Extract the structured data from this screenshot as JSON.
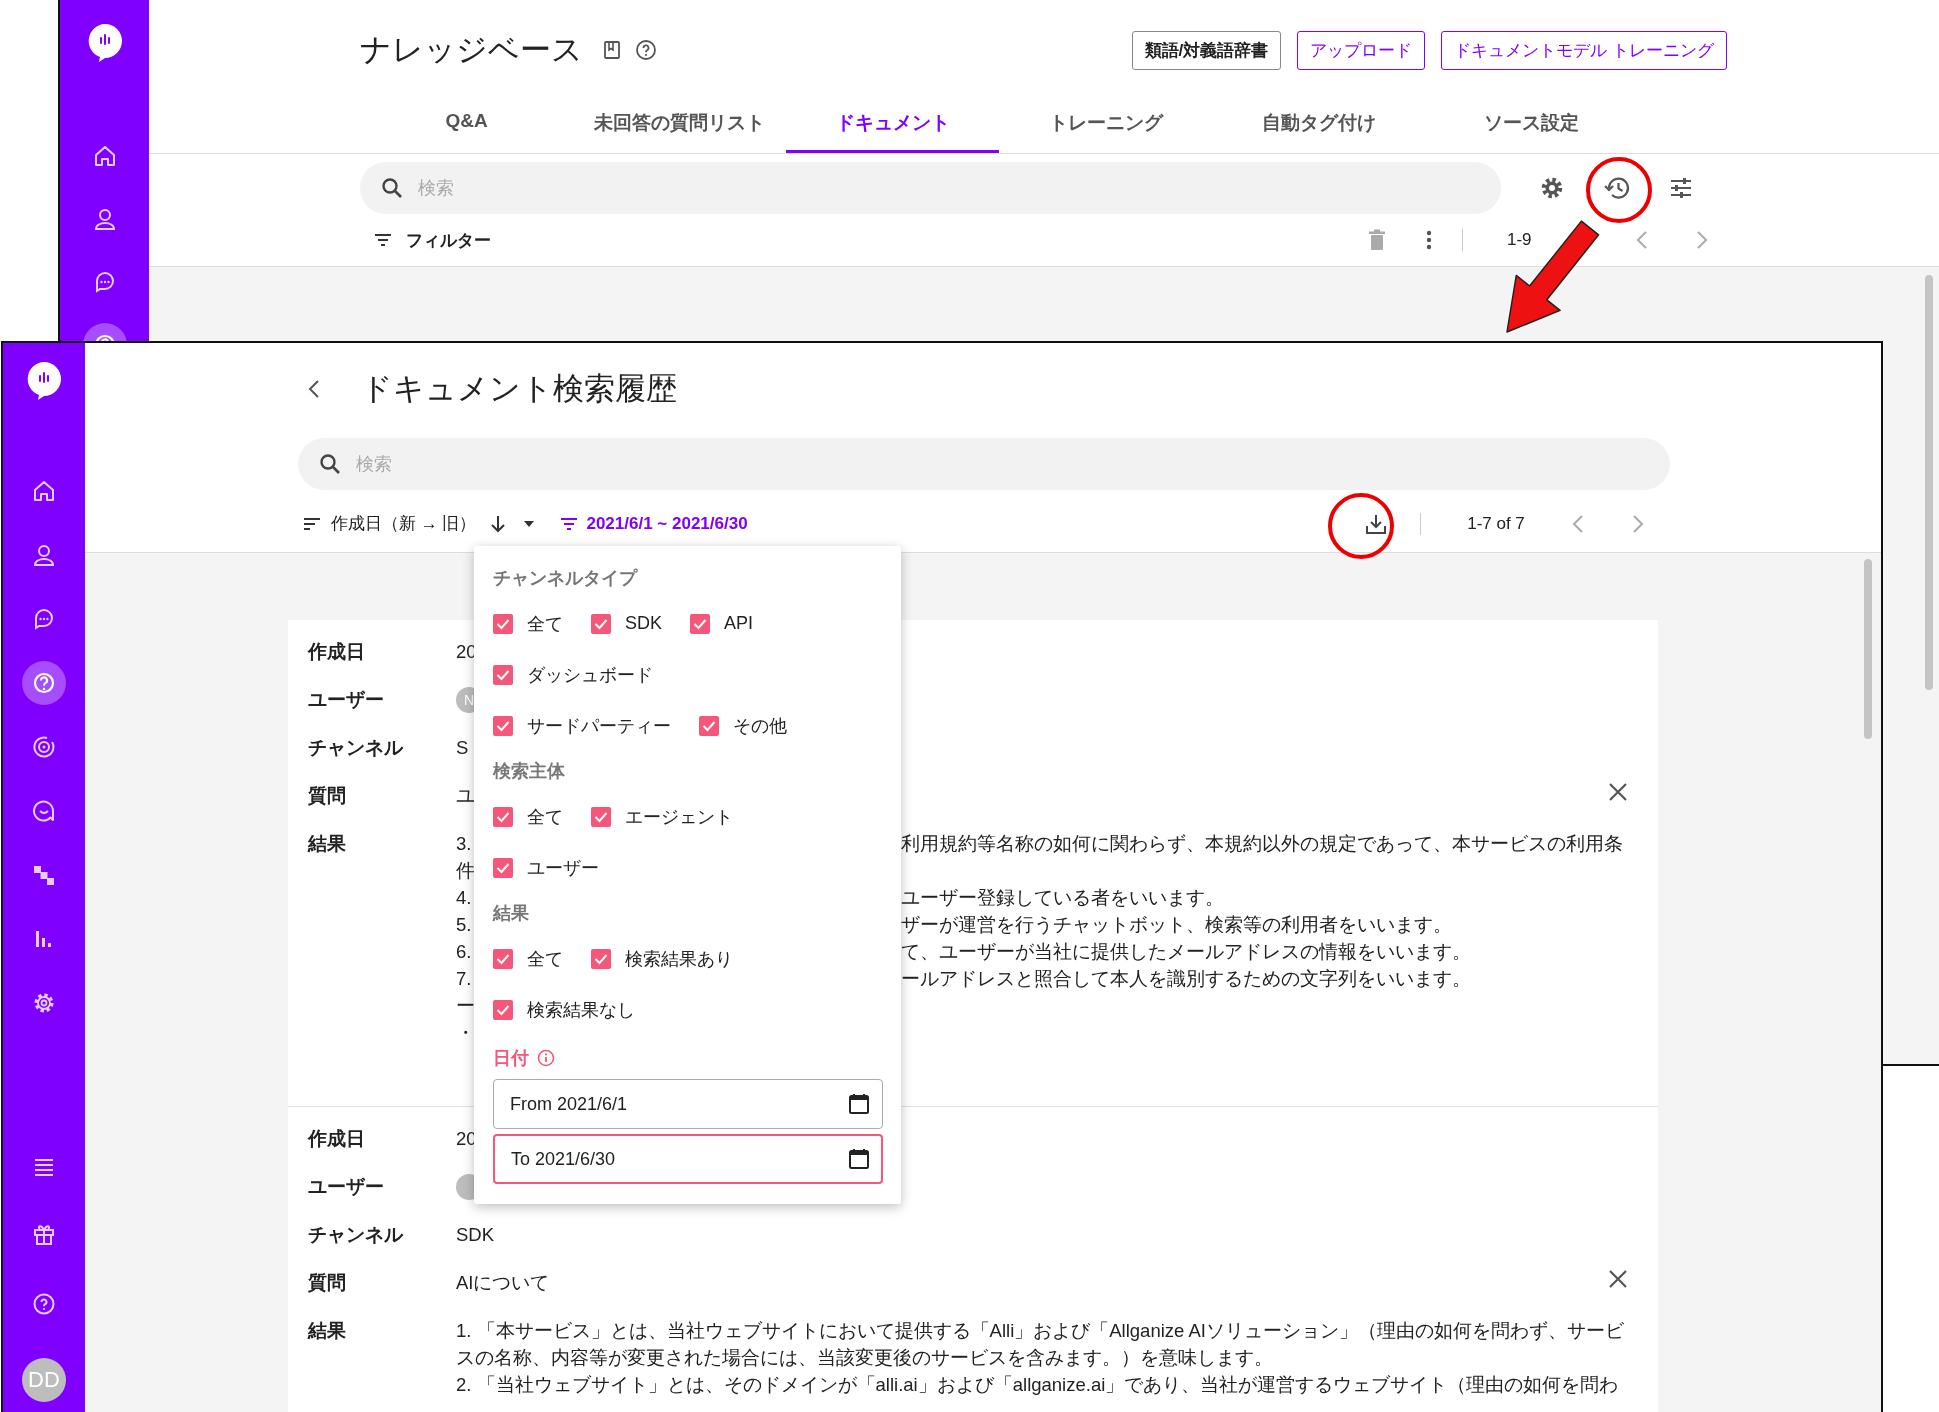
{
  "background_window": {
    "sidebar_items": [
      {
        "selected": false
      },
      {
        "selected": false
      },
      {
        "selected": false
      },
      {
        "selected": true
      }
    ],
    "title": "ナレッジベース",
    "header_buttons": [
      {
        "label": "類語/対義語辞書",
        "kind": "outlined"
      },
      {
        "label": "アップロード",
        "kind": "accent"
      },
      {
        "label": "ドキュメントモデル トレーニング",
        "kind": "accent"
      }
    ],
    "tabs": [
      {
        "label": "Q&A",
        "selected": false
      },
      {
        "label": "未回答の質問リスト",
        "selected": false
      },
      {
        "label": "ドキュメント",
        "selected": true
      },
      {
        "label": "トレーニング",
        "selected": false
      },
      {
        "label": "自動タグ付け",
        "selected": false
      },
      {
        "label": "ソース設定",
        "selected": false
      }
    ],
    "search": {
      "placeholder": "検索"
    },
    "filter_label": "フィルター",
    "pagination": "1-9"
  },
  "front_window": {
    "sidebar_items": [
      {
        "selected": false
      },
      {
        "selected": false
      },
      {
        "selected": false
      },
      {
        "selected": true
      },
      {
        "selected": false
      },
      {
        "selected": false
      },
      {
        "selected": false
      },
      {
        "selected": false
      },
      {
        "selected": false
      }
    ],
    "avatar": {
      "initials": "DD"
    },
    "title": "ドキュメント検索履歴",
    "search": {
      "placeholder": "検索"
    },
    "sort_label": "作成日（新 → 旧）",
    "date_filter": "2021/6/1 ~ 2021/6/30",
    "pagination": "1-7 of 7",
    "records": [
      {
        "fields": [
          {
            "label": "作成日",
            "kind": "text",
            "value": "20"
          },
          {
            "label": "ユーザー",
            "kind": "avatar",
            "initials": "N"
          },
          {
            "label": "チャンネル",
            "kind": "text",
            "value": "S"
          },
          {
            "label": "質問",
            "kind": "text",
            "value": "ユ"
          },
          {
            "label": "結果",
            "kind": "lines",
            "lines": [
              {
                "start": "3.",
                "end": "利用規約等名称の如何に関わらず、本規約以外の規定であって、本サービスの利用条"
              },
              {
                "start": "件"
              },
              {
                "start": "4.",
                "end": "ユーザー登録している者をいいます。"
              },
              {
                "start": "5.",
                "end": "ザーが運営を行うチャットボット、検索等の利用者をいいます。"
              },
              {
                "start": "6.",
                "end": "て、ユーザーが当社に提供したメールアドレスの情報をいいます。"
              },
              {
                "start": "7.",
                "end": "ールアドレスと照合して本人を識別するための文字列をいいます。"
              },
              {
                "start": "ー"
              },
              {
                "start": "・"
              }
            ]
          }
        ]
      },
      {
        "fields": [
          {
            "label": "作成日",
            "kind": "text",
            "value": "20"
          },
          {
            "label": "ユーザー",
            "kind": "avatar"
          },
          {
            "label": "チャンネル",
            "kind": "text",
            "value": "SDK"
          },
          {
            "label": "質問",
            "kind": "text",
            "value": "AIについて"
          },
          {
            "label": "結果",
            "kind": "lines",
            "lines": [
              {
                "text": "1. 「本サービス」とは、当社ウェブサイトにおいて提供する「Alli」および「Allganize AIソリューション」（理由の如何を問わず、サービ"
              },
              {
                "text": "スの名称、内容等が変更された場合には、当該変更後のサービスを含みます。）を意味します。"
              },
              {
                "text": "2. 「当社ウェブサイト」とは、そのドメインが「alli.ai」および「allganize.ai」であり、当社が運営するウェブサイト（理由の如何を問わ"
              }
            ]
          }
        ]
      }
    ],
    "filter_popup": {
      "sections": [
        {
          "title": "チャンネルタイプ",
          "options": [
            {
              "label": "全て",
              "checked": true
            },
            {
              "label": "SDK",
              "checked": true
            },
            {
              "label": "API",
              "checked": true
            },
            {
              "label": "ダッシュボード",
              "checked": true
            },
            {
              "label": "サードパーティー",
              "checked": true
            },
            {
              "label": "その他",
              "checked": true
            }
          ]
        },
        {
          "title": "検索主体",
          "options": [
            {
              "label": "全て",
              "checked": true
            },
            {
              "label": "エージェント",
              "checked": true
            },
            {
              "label": "ユーザー",
              "checked": true
            }
          ]
        },
        {
          "title": "結果",
          "options": [
            {
              "label": "全て",
              "checked": true
            },
            {
              "label": "検索結果あり",
              "checked": true
            },
            {
              "label": "検索結果なし",
              "checked": true
            }
          ]
        }
      ],
      "date": {
        "label": "日付",
        "fields": [
          {
            "value": "From 2021/6/1",
            "focused": false
          },
          {
            "value": "To 2021/6/30",
            "focused": true
          }
        ]
      }
    }
  }
}
